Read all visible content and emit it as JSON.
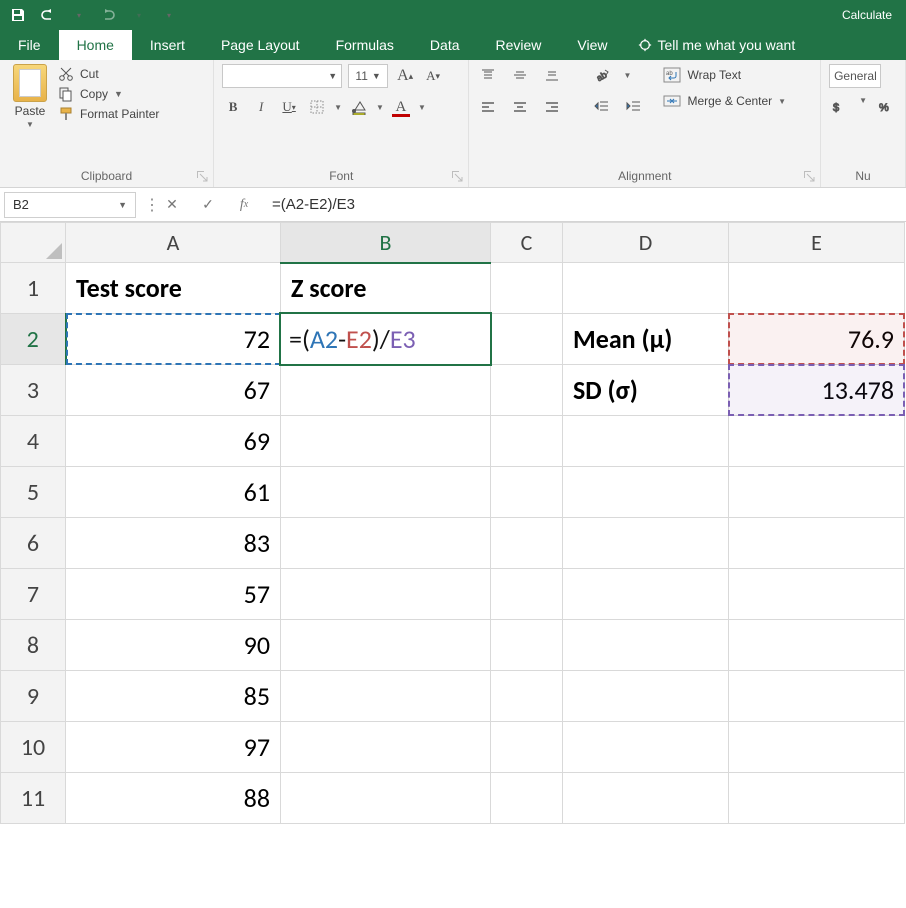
{
  "titlebar": {
    "calc_label": "Calculate"
  },
  "tabs": {
    "file": "File",
    "home": "Home",
    "insert": "Insert",
    "page_layout": "Page Layout",
    "formulas": "Formulas",
    "data": "Data",
    "review": "Review",
    "view": "View",
    "tellme": "Tell me what you want"
  },
  "ribbon": {
    "clipboard": {
      "paste": "Paste",
      "cut": "Cut",
      "copy": "Copy",
      "format_painter": "Format Painter",
      "label": "Clipboard"
    },
    "font": {
      "font_name": "",
      "font_size": "11",
      "label": "Font"
    },
    "alignment": {
      "wrap": "Wrap Text",
      "merge": "Merge & Center",
      "label": "Alignment"
    },
    "number": {
      "format": "General",
      "label": "Nu"
    }
  },
  "formula_bar": {
    "name_box": "B2",
    "formula": "=(A2-E2)/E3"
  },
  "columns": {
    "A": "A",
    "B": "B",
    "C": "C",
    "D": "D",
    "E": "E"
  },
  "rows": {
    "1": "1",
    "2": "2",
    "3": "3",
    "4": "4",
    "5": "5",
    "6": "6",
    "7": "7",
    "8": "8",
    "9": "9",
    "10": "10",
    "11": "11"
  },
  "cells": {
    "A1": "Test score",
    "B1": "Z score",
    "A2": "72",
    "B2_parts": {
      "eq": "=(",
      "a": "A2",
      "dash": "-",
      "e2": "E2",
      "mid": ")/",
      "e3": "E3"
    },
    "D2": "Mean (μ)",
    "E2": "76.9",
    "A3": "67",
    "D3": "SD (σ)",
    "E3": "13.478",
    "A4": "69",
    "A5": "61",
    "A6": "83",
    "A7": "57",
    "A8": "90",
    "A9": "85",
    "A10": "97",
    "A11": "88"
  }
}
